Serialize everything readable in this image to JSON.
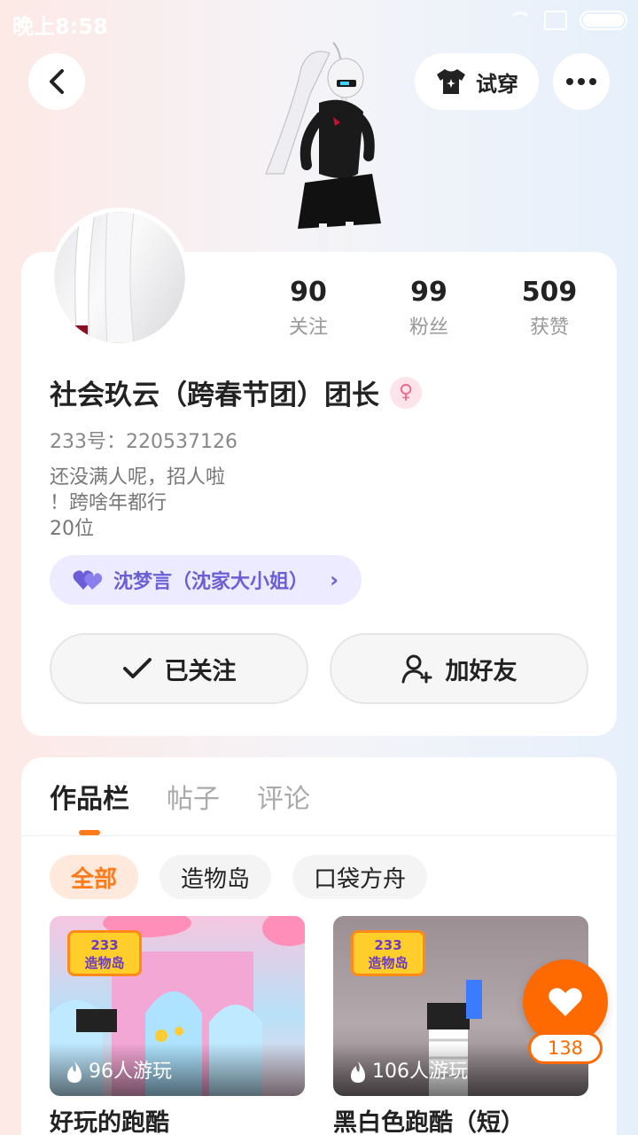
{
  "status_bar": {
    "time": "晚上8:58"
  },
  "header": {
    "try_on_label": "试穿"
  },
  "profile": {
    "stats": [
      {
        "value": "90",
        "label": "关注"
      },
      {
        "value": "99",
        "label": "粉丝"
      },
      {
        "value": "509",
        "label": "获赞"
      }
    ],
    "name": "社会玖云（跨春节团）团长",
    "gender_symbol": "♀",
    "uid": "233号：220537126",
    "bio_lines": [
      "还没满人呢，招人啦",
      "！跨啥年都行",
      "20位"
    ],
    "relation_tag": "沈梦言（沈家大小姐）",
    "follow_button": "已关注",
    "add_friend_button": "加好友"
  },
  "content": {
    "tabs": [
      "作品栏",
      "帖子",
      "评论"
    ],
    "active_tab": 0,
    "filters": [
      "全部",
      "造物岛",
      "口袋方舟"
    ],
    "active_filter": 0,
    "works": [
      {
        "title": "好玩的跑酷",
        "players": "96人游玩",
        "badge_top": "233",
        "badge_bottom": "造物岛"
      },
      {
        "title": "黑白色跑酷（短）",
        "players": "106人游玩",
        "badge_top": "233",
        "badge_bottom": "造物岛"
      }
    ]
  },
  "like_fab": {
    "count": "138"
  },
  "colors": {
    "accent": "#ff7a1a",
    "tag_purple": "#6b5fd8",
    "gender_pink": "#f06a8f"
  }
}
